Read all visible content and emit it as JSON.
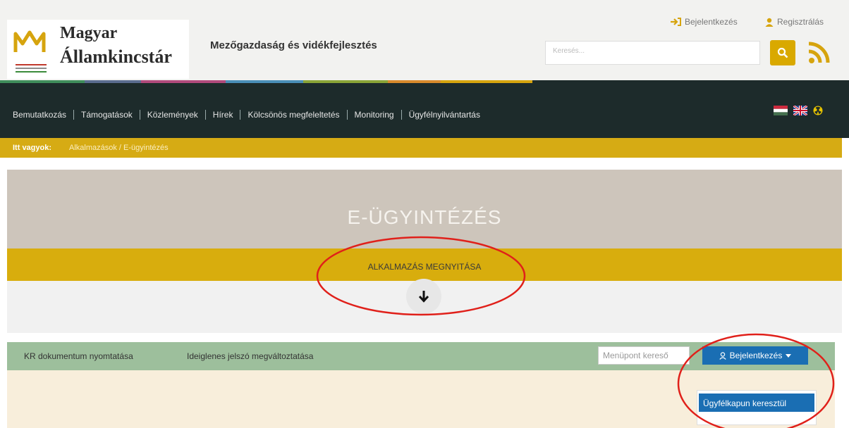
{
  "header": {
    "logo_line1": "Magyar",
    "logo_line2": "Államkincstár",
    "topic": "Mezőgazdaság és vidékfejlesztés",
    "login_link": "Bejelentkezés",
    "register_link": "Regisztrálás",
    "search_placeholder": "Keresés..."
  },
  "nav": {
    "items": [
      "Bemutatkozás",
      "Támogatások",
      "Közlemények",
      "Hírek",
      "Kölcsönös megfeleltetés",
      "Monitoring",
      "Ügyfélnyilvántartás"
    ]
  },
  "breadcrumb": {
    "label": "Itt vagyok:",
    "path": "Alkalmazások / E-ügyintézés"
  },
  "hero": {
    "title": "E-ÜGYINTÉZÉS",
    "open_label": "ALKALMAZÁS MEGNYITÁSA"
  },
  "toolbar": {
    "link1": "KR dokumentum nyomtatása",
    "link2": "Ideiglenes jelszó megváltoztatása",
    "menu_search_placeholder": "Menüpont kereső",
    "login_button": "Bejelentkezés",
    "dropdown_item": "Ügyfélkapun keresztül"
  },
  "colors": {
    "nav_bg": "#1d2b2b",
    "gold": "#d8ad0d",
    "toolbar_green": "#9dbf9c",
    "primary_blue": "#1a6eb3",
    "annotation_red": "#e0201a"
  },
  "icons": [
    "login-arrow-icon",
    "user-icon",
    "search-icon",
    "rss-icon",
    "hungarian-flag-icon",
    "uk-flag-icon",
    "accessibility-icon",
    "arrow-down-icon",
    "caret-down-icon"
  ]
}
